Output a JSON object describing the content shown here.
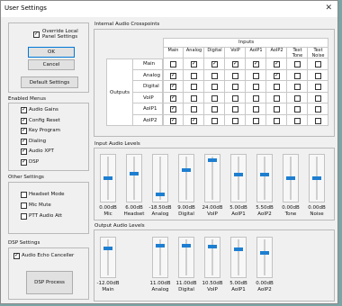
{
  "window": {
    "title": "User Settings"
  },
  "left": {
    "override_label": "Override Local Panel Settings",
    "ok": "OK",
    "cancel": "Cancel",
    "default": "Default Settings",
    "enabled_menus_title": "Enabled Menus",
    "enabled_menus": [
      {
        "label": "Audio Gains",
        "checked": true
      },
      {
        "label": "Config Reset",
        "checked": true
      },
      {
        "label": "Key Program",
        "checked": true
      },
      {
        "label": "Dialing",
        "checked": true
      },
      {
        "label": "Audio XPT",
        "checked": true
      },
      {
        "label": "DSP",
        "checked": true
      }
    ],
    "other_title": "Other Settings",
    "other": [
      {
        "label": "Headset Mode",
        "checked": false
      },
      {
        "label": "Mic Mute",
        "checked": false
      },
      {
        "label": "PTT Audio Att",
        "checked": false
      }
    ],
    "dsp_title": "DSP Settings",
    "echo_label": "Audio Echo Canceller",
    "echo_checked": true,
    "dsp_process": "DSP Process"
  },
  "crosspoints": {
    "title": "Internal Audio Crosspoints",
    "inputs_label": "Inputs",
    "outputs_label": "Outputs",
    "columns": [
      "Main",
      "Analog",
      "Digital",
      "VoIP",
      "AoIP1",
      "AoIP2",
      "Text Tone",
      "Text Noise"
    ],
    "rows": [
      {
        "label": "Main",
        "checks": [
          false,
          true,
          true,
          true,
          true,
          true,
          false,
          false
        ]
      },
      {
        "label": "Analog",
        "checks": [
          true,
          false,
          false,
          false,
          false,
          true,
          false,
          false
        ]
      },
      {
        "label": "Digital",
        "checks": [
          true,
          false,
          false,
          false,
          false,
          false,
          false,
          false
        ]
      },
      {
        "label": "VoIP",
        "checks": [
          true,
          false,
          false,
          false,
          false,
          false,
          false,
          false
        ]
      },
      {
        "label": "AoIP1",
        "checks": [
          true,
          false,
          false,
          false,
          false,
          false,
          false,
          false
        ]
      },
      {
        "label": "AoIP2",
        "checks": [
          true,
          true,
          false,
          false,
          false,
          false,
          false,
          false
        ]
      }
    ]
  },
  "input_levels": {
    "title": "Input Audio Levels",
    "channels": [
      {
        "value": "0.00dB",
        "name": "Mic",
        "level": 0.5
      },
      {
        "value": "6.00dB",
        "name": "Headset",
        "level": 0.62
      },
      {
        "value": "-18.50dB",
        "name": "Analog",
        "level": 0.1
      },
      {
        "value": "9.00dB",
        "name": "Digital",
        "level": 0.7
      },
      {
        "value": "24.00dB",
        "name": "VoIP",
        "level": 0.95
      },
      {
        "value": "5.00dB",
        "name": "AoIP1",
        "level": 0.6
      },
      {
        "value": "5.50dB",
        "name": "AoIP2",
        "level": 0.6
      },
      {
        "value": "0.00dB",
        "name": "Tone",
        "level": 0.5
      },
      {
        "value": "0.00dB",
        "name": "Noise",
        "level": 0.5
      }
    ]
  },
  "output_levels": {
    "title": "Output Audio Levels",
    "channels": [
      {
        "value": "-12.00dB",
        "name": "Main",
        "level": 0.78
      },
      {
        "value": "11.00dB",
        "name": "Analog",
        "level": 0.85
      },
      {
        "value": "11.00dB",
        "name": "Digital",
        "level": 0.85
      },
      {
        "value": "10.50dB",
        "name": "VoIP",
        "level": 0.84
      },
      {
        "value": "5.00dB",
        "name": "AoIP1",
        "level": 0.75
      },
      {
        "value": "0.00dB",
        "name": "AoIP2",
        "level": 0.65
      }
    ]
  }
}
